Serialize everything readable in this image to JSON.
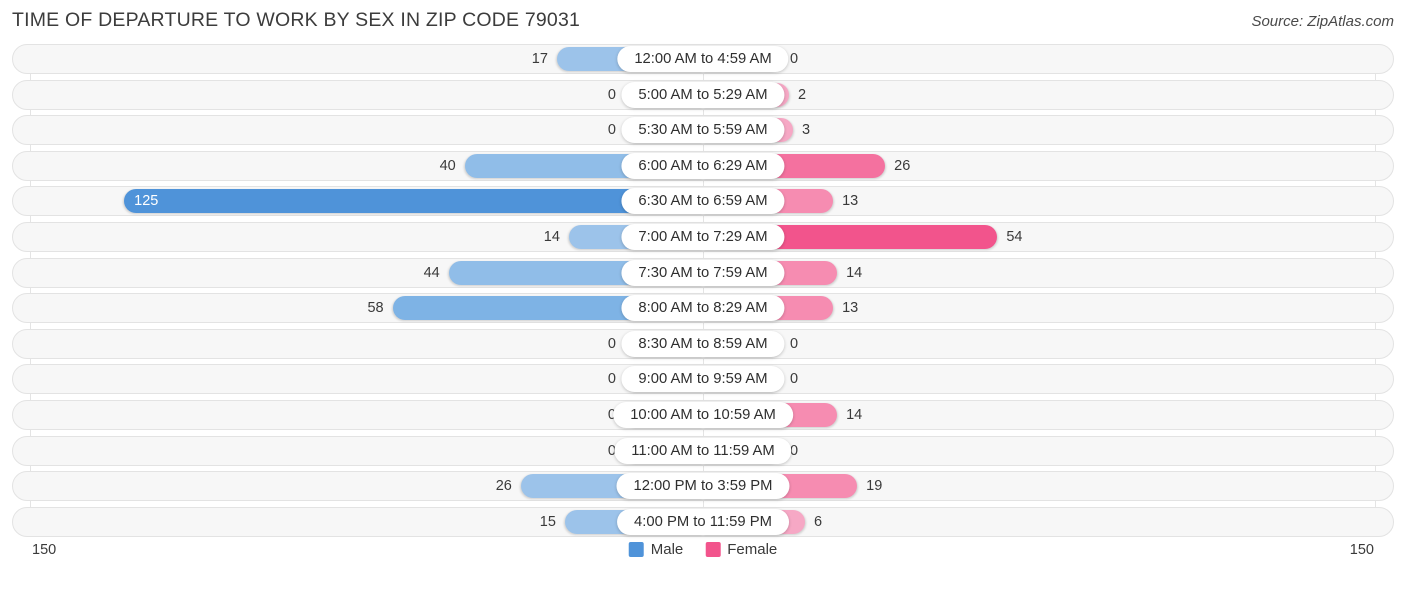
{
  "header": {
    "title": "TIME OF DEPARTURE TO WORK BY SEX IN ZIP CODE 79031",
    "source": "Source: ZipAtlas.com"
  },
  "axis": {
    "left_end_label": "150",
    "right_end_label": "150"
  },
  "legend": {
    "items": [
      {
        "label": "Male",
        "color": "#4f93d9"
      },
      {
        "label": "Female",
        "color": "#f2548c"
      }
    ]
  },
  "chart_data": {
    "type": "bar",
    "orientation": "horizontal-diverging",
    "title": "TIME OF DEPARTURE TO WORK BY SEX IN ZIP CODE 79031",
    "xlabel": "",
    "ylabel": "",
    "xlim": [
      -150,
      150
    ],
    "axis_max": 150,
    "grid": true,
    "legend_position": "bottom-center",
    "categories": [
      "12:00 AM to 4:59 AM",
      "5:00 AM to 5:29 AM",
      "5:30 AM to 5:59 AM",
      "6:00 AM to 6:29 AM",
      "6:30 AM to 6:59 AM",
      "7:00 AM to 7:29 AM",
      "7:30 AM to 7:59 AM",
      "8:00 AM to 8:29 AM",
      "8:30 AM to 8:59 AM",
      "9:00 AM to 9:59 AM",
      "10:00 AM to 10:59 AM",
      "11:00 AM to 11:59 AM",
      "12:00 PM to 3:59 PM",
      "4:00 PM to 11:59 PM"
    ],
    "series": [
      {
        "name": "Male",
        "side": "left",
        "values": [
          17,
          0,
          0,
          40,
          125,
          14,
          44,
          58,
          0,
          0,
          0,
          0,
          26,
          15
        ]
      },
      {
        "name": "Female",
        "side": "right",
        "values": [
          0,
          2,
          3,
          26,
          13,
          54,
          14,
          13,
          0,
          0,
          14,
          0,
          19,
          6
        ]
      }
    ]
  },
  "rows": [
    {
      "label": "12:00 AM to 4:59 AM",
      "male": "17",
      "female": "0",
      "male_value": 17,
      "female_value": 0
    },
    {
      "label": "5:00 AM to 5:29 AM",
      "male": "0",
      "female": "2",
      "male_value": 0,
      "female_value": 2
    },
    {
      "label": "5:30 AM to 5:59 AM",
      "male": "0",
      "female": "3",
      "male_value": 0,
      "female_value": 3
    },
    {
      "label": "6:00 AM to 6:29 AM",
      "male": "40",
      "female": "26",
      "male_value": 40,
      "female_value": 26
    },
    {
      "label": "6:30 AM to 6:59 AM",
      "male": "125",
      "female": "13",
      "male_value": 125,
      "female_value": 13
    },
    {
      "label": "7:00 AM to 7:29 AM",
      "male": "14",
      "female": "54",
      "male_value": 14,
      "female_value": 54
    },
    {
      "label": "7:30 AM to 7:59 AM",
      "male": "44",
      "female": "14",
      "male_value": 44,
      "female_value": 14
    },
    {
      "label": "8:00 AM to 8:29 AM",
      "male": "58",
      "female": "13",
      "male_value": 58,
      "female_value": 13
    },
    {
      "label": "8:30 AM to 8:59 AM",
      "male": "0",
      "female": "0",
      "male_value": 0,
      "female_value": 0
    },
    {
      "label": "9:00 AM to 9:59 AM",
      "male": "0",
      "female": "0",
      "male_value": 0,
      "female_value": 0
    },
    {
      "label": "10:00 AM to 10:59 AM",
      "male": "0",
      "female": "14",
      "male_value": 0,
      "female_value": 14
    },
    {
      "label": "11:00 AM to 11:59 AM",
      "male": "0",
      "female": "0",
      "male_value": 0,
      "female_value": 0
    },
    {
      "label": "12:00 PM to 3:59 PM",
      "male": "26",
      "female": "19",
      "male_value": 26,
      "female_value": 19
    },
    {
      "label": "4:00 PM to 11:59 PM",
      "male": "15",
      "female": "6",
      "male_value": 15,
      "female_value": 6
    }
  ]
}
